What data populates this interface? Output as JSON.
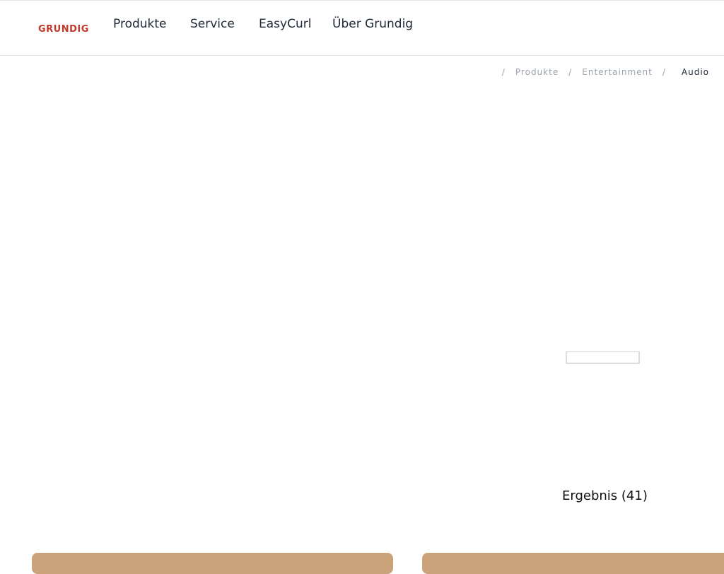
{
  "header": {
    "logo": "GRUNDIG",
    "nav": [
      "Produkte",
      "Service",
      "EasyCurl",
      "Über Grundig"
    ]
  },
  "breadcrumb": {
    "separator": "/",
    "items": [
      "Produkte",
      "Entertainment",
      "Audio"
    ]
  },
  "results": {
    "label": "Ergebnis (41)"
  },
  "colors": {
    "brand": "#c0392b",
    "card": "#cba37b"
  }
}
